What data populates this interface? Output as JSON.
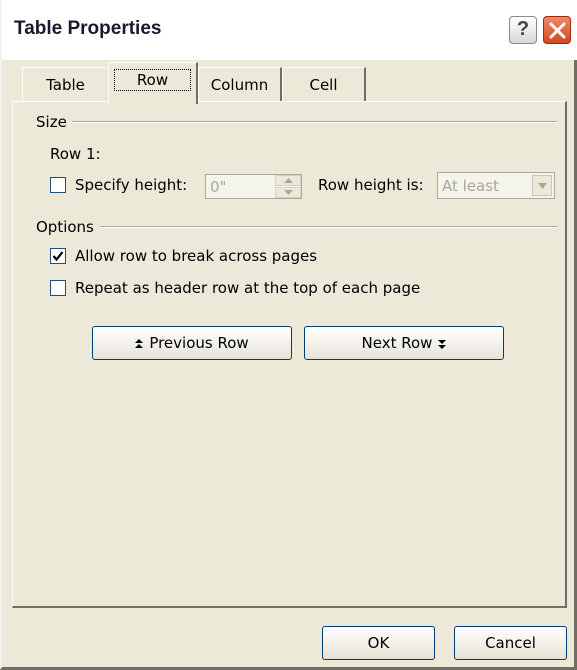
{
  "window": {
    "title": "Table Properties"
  },
  "tabs": [
    {
      "label": "Table"
    },
    {
      "label": "Row",
      "active": true
    },
    {
      "label": "Column"
    },
    {
      "label": "Cell"
    }
  ],
  "size_group": {
    "heading": "Size",
    "row_label": "Row 1:",
    "specify_height_label": "Specify height:",
    "specify_height_checked": false,
    "height_value": "0\"",
    "row_height_is_label": "Row height is:",
    "row_height_is_value": "At least"
  },
  "options_group": {
    "heading": "Options",
    "allow_break_label": "Allow row to break across pages",
    "allow_break_checked": true,
    "repeat_header_label": "Repeat as header row at the top of each page",
    "repeat_header_checked": false
  },
  "nav": {
    "previous_row": "Previous Row",
    "next_row": "Next Row"
  },
  "footer": {
    "ok": "OK",
    "cancel": "Cancel"
  },
  "colors": {
    "face": "#ece9d8",
    "close": "#d2481e",
    "disabled_text": "#aca899"
  }
}
